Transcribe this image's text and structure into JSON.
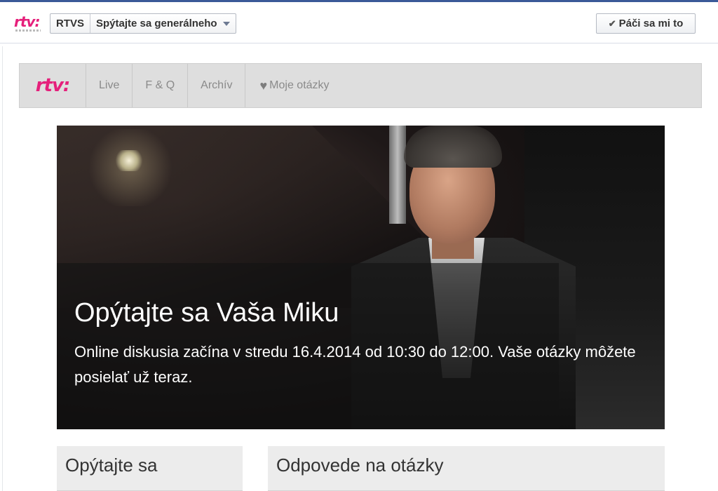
{
  "fb_header": {
    "logo_text": "rtv:",
    "page_name": "RTVS",
    "app_name": "Spýtajte sa generálneho",
    "like_label": "Páči sa mi to"
  },
  "nav": {
    "logo_text": "rtv:",
    "items": [
      {
        "label": "Live"
      },
      {
        "label": "F & Q"
      },
      {
        "label": "Archív"
      },
      {
        "label": "Moje otázky",
        "icon": "heart-icon"
      }
    ]
  },
  "hero": {
    "title": "Opýtajte sa Vaša Miku",
    "text": "Online diskusia začína v stredu 16.4.2014 od 10:30 do 12:00. Vaše otázky môžete posielať už teraz."
  },
  "sections": {
    "ask_title": "Opýtajte sa",
    "answers_title": "Odpovede na otázky"
  },
  "colors": {
    "brand_pink": "#e5207b",
    "facebook_blue": "#3b5998",
    "nav_bg": "#dedede"
  }
}
